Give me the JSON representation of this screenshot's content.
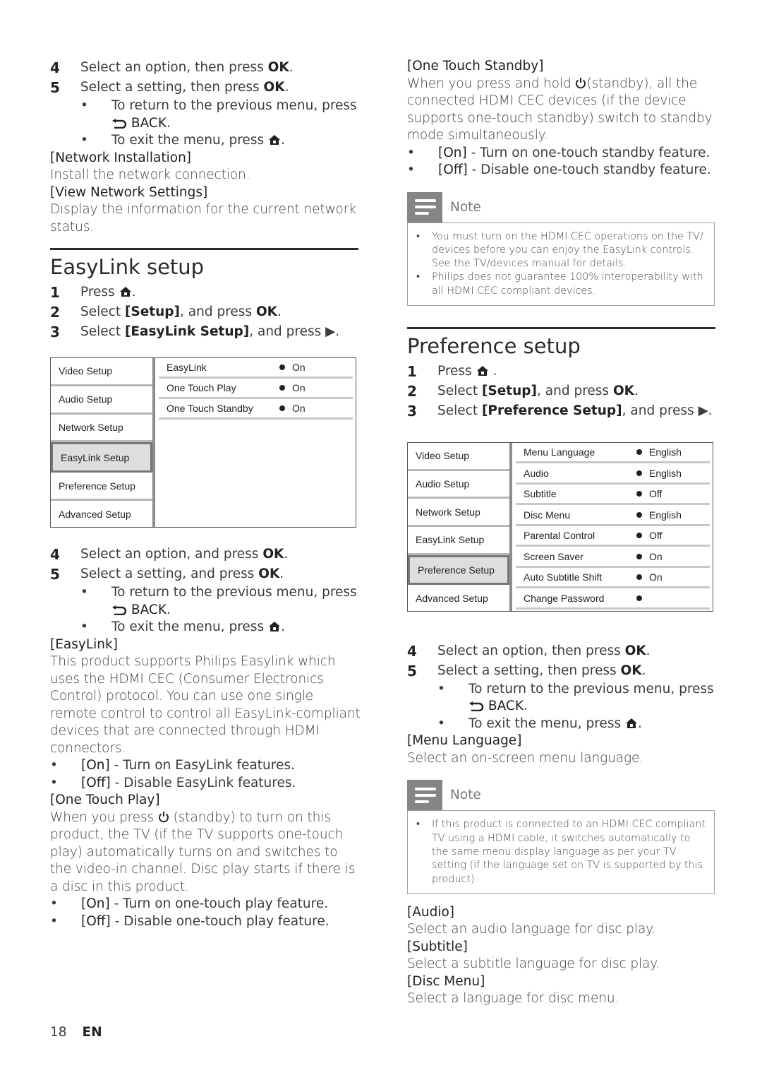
{
  "left": {
    "intro_steps": [
      {
        "num": "4",
        "pre": "Select an option, then press ",
        "bold": "OK",
        "post": "."
      },
      {
        "num": "5",
        "pre": "Select a setting, then press ",
        "bold": "OK",
        "post": "."
      }
    ],
    "intro_bullets": {
      "return_text": "To return to the previous menu, press",
      "back_label": "BACK",
      "exit_text": "To exit the menu, press"
    },
    "network_installation": {
      "heading": "[Network Installation]",
      "text": "Install the network connection."
    },
    "view_network_settings": {
      "heading": "[View Network Settings]",
      "text": "Display the information for the current network status."
    },
    "easylink": {
      "title": "EasyLink setup",
      "steps": {
        "s1": {
          "num": "1",
          "pre": "Press "
        },
        "s2": {
          "num": "2",
          "pre": "Select ",
          "bold": "[Setup]",
          "post": ", and press ",
          "bold2": "OK",
          "end": "."
        },
        "s3": {
          "num": "3",
          "pre": "Select ",
          "bold": "[EasyLink Setup]",
          "post": ", and press "
        }
      },
      "menu": {
        "categories": [
          "Video Setup",
          "Audio Setup",
          "Network Setup",
          "EasyLink Setup",
          "Preference Setup",
          "Advanced Setup"
        ],
        "selected": "EasyLink Setup",
        "options": [
          {
            "label": "EasyLink",
            "value": "On"
          },
          {
            "label": "One Touch Play",
            "value": "On"
          },
          {
            "label": "One Touch Standby",
            "value": "On"
          }
        ]
      },
      "steps2": [
        {
          "num": "4",
          "pre": "Select an option, and press ",
          "bold": "OK",
          "post": "."
        },
        {
          "num": "5",
          "pre": "Select a setting, and press ",
          "bold": "OK",
          "post": "."
        }
      ],
      "bullets": {
        "return_text": "To return to the previous menu, press",
        "back_label": "BACK",
        "exit_text": "To exit the menu, press"
      },
      "easylink_option": {
        "heading": "[EasyLink]",
        "text": "This product supports Philips Easylink which uses the HDMI CEC (Consumer Electronics Control) protocol. You can use one single remote control to control all EasyLink-compliant devices that are connected through HDMI connectors.",
        "on_label": "[On]",
        "on_text": " - Turn on EasyLink features.",
        "off_label": "[Off]",
        "off_text": " - Disable EasyLink features."
      },
      "one_touch_play": {
        "heading": "[One Touch Play]",
        "text_pre": "When you press ",
        "text_post": " (standby) to turn on this product, the TV (if the TV supports one-touch play) automatically turns on and switches to the video-in channel. Disc play starts if there is a disc in this product.",
        "on_label": "[On]",
        "on_text": " - Turn on one-touch play feature.",
        "off_label": "[Off]",
        "off_text": " - Disable one-touch play feature."
      }
    }
  },
  "right": {
    "one_touch_standby": {
      "heading": "[One Touch Standby]",
      "text_pre": "When you press and hold ",
      "text_post": "(standby), all the connected HDMI CEC devices (if the device supports one-touch standby) switch to standby mode simultaneously.",
      "on_label": "[On]",
      "on_text": " - Turn on one-touch standby feature.",
      "off_label": "[Off]",
      "off_text": " - Disable one-touch standby feature."
    },
    "note1": {
      "label": "Note",
      "items": [
        "You must turn on the HDMI CEC operations on the TV/ devices before you can enjoy the EasyLink controls. See the TV/devices manual for details.",
        "Philips does not guarantee 100% interoperability with all HDMI CEC compliant devices."
      ]
    },
    "preference": {
      "title": "Preference setup",
      "steps": {
        "s1": {
          "num": "1",
          "pre": "Press "
        },
        "s2": {
          "num": "2",
          "pre": "Select ",
          "bold": "[Setup]",
          "post": ", and press ",
          "bold2": "OK",
          "end": "."
        },
        "s3": {
          "num": "3",
          "pre": "Select ",
          "bold": "[Preference Setup]",
          "post": ", and press "
        }
      },
      "menu": {
        "categories": [
          "Video Setup",
          "Audio Setup",
          "Network Setup",
          "EasyLink Setup",
          "Preference Setup",
          "Advanced Setup"
        ],
        "selected": "Preference Setup",
        "options": [
          {
            "label": "Menu Language",
            "value": "English"
          },
          {
            "label": "Audio",
            "value": "English"
          },
          {
            "label": "Subtitle",
            "value": "Off"
          },
          {
            "label": "Disc Menu",
            "value": "English"
          },
          {
            "label": "Parental Control",
            "value": "Off"
          },
          {
            "label": "Screen Saver",
            "value": "On"
          },
          {
            "label": "Auto Subtitle Shift",
            "value": "On"
          },
          {
            "label": "Change Password",
            "value": ""
          }
        ]
      },
      "steps2": [
        {
          "num": "4",
          "pre": "Select an option, then press ",
          "bold": "OK",
          "post": "."
        },
        {
          "num": "5",
          "pre": "Select a setting, then press ",
          "bold": "OK",
          "post": "."
        }
      ],
      "bullets": {
        "return_text": "To return to the previous menu, press",
        "back_label": "BACK",
        "exit_text": "To exit the menu, press"
      },
      "menu_language": {
        "heading": "[Menu Language]",
        "text": "Select an on-screen menu language."
      },
      "note2": {
        "label": "Note",
        "items": [
          "If this product is connected to an HDMI CEC compliant TV using a HDMI cable, it switches automatically to the same menu display language as per your TV setting (if the language set on TV is supported by this product)."
        ]
      },
      "audio": {
        "heading": "[Audio]",
        "text": "Select an audio language for disc play."
      },
      "subtitle": {
        "heading": "[Subtitle]",
        "text": "Select a subtitle language for disc play."
      },
      "disc_menu": {
        "heading": "[Disc Menu]",
        "text": "Select a language for disc menu."
      }
    }
  },
  "footer": {
    "page": "18",
    "lang": "EN"
  }
}
